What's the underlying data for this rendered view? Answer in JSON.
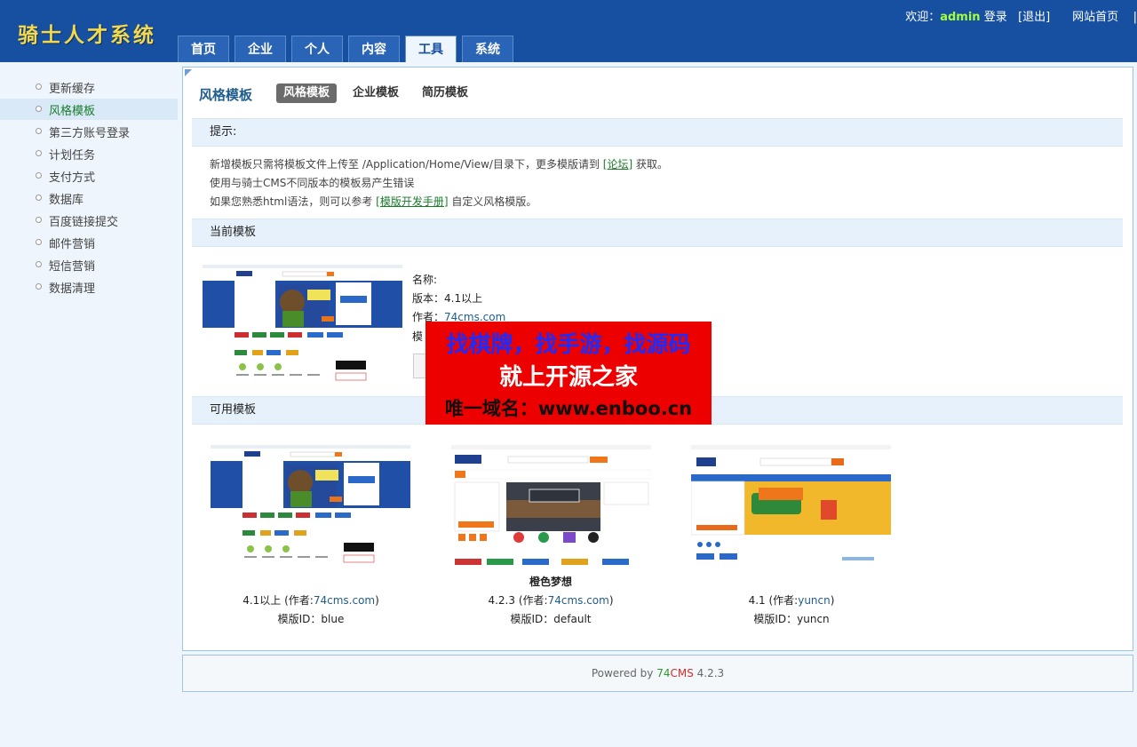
{
  "app": {
    "logo": "骑士人才系统"
  },
  "header": {
    "welcome": "欢迎：",
    "username": "admin",
    "login": "登录",
    "logout": "[退出]",
    "site_home": "网站首页",
    "separator": "|"
  },
  "nav": {
    "tabs": [
      "首页",
      "企业",
      "个人",
      "内容",
      "工具",
      "系统"
    ],
    "active": "工具"
  },
  "sidebar": {
    "items": [
      "更新缓存",
      "风格模板",
      "第三方账号登录",
      "计划任务",
      "支付方式",
      "数据库",
      "百度链接提交",
      "邮件营销",
      "短信营销",
      "数据清理"
    ],
    "active": "风格模板"
  },
  "page": {
    "title": "风格模板",
    "subtabs": [
      "风格模板",
      "企业模板",
      "简历模板"
    ],
    "active_subtab": "风格模板"
  },
  "tips": {
    "header": "提示:",
    "line1_pre": "新增模板只需将模板文件上传至 /Application/Home/View/目录下，更多模版请到 ",
    "line1_link": "[论坛]",
    "line1_post": " 获取。",
    "line2": "使用与骑士CMS不同版本的模板易产生错误",
    "line3_pre": "如果您熟悉html语法，则可以参考 ",
    "line3_link": "[模版开发手册]",
    "line3_post": " 自定义风格模版。"
  },
  "current": {
    "header": "当前模板",
    "name_label": "名称:",
    "name_value": "",
    "version_label": "版本：",
    "version_value": "4.1以上",
    "author_label": "作者：",
    "author_value": "74cms.com",
    "id_label": "模"
  },
  "available": {
    "header": "可用模板",
    "templates": [
      {
        "name": "",
        "version": "4.1以上",
        "author_label": "(作者:",
        "author": "74cms.com",
        "author_close": ")",
        "id_label": "模版ID：",
        "id": "blue"
      },
      {
        "name": "橙色梦想",
        "version": "4.2.3",
        "author_label": "(作者:",
        "author": "74cms.com",
        "author_close": ")",
        "id_label": "模版ID：",
        "id": "default"
      },
      {
        "name": "",
        "version": "4.1",
        "author_label": "(作者:",
        "author": "yuncn",
        "author_close": ")",
        "id_label": "模版ID：",
        "id": "yuncn"
      }
    ]
  },
  "footer": {
    "powered": "Powered by ",
    "brand_a": "74",
    "brand_b": "CMS",
    "version": " 4.2.3"
  },
  "overlay": {
    "line1": "找棋牌，找手游，找源码",
    "line2": "就上开源之家",
    "line3": "唯一域名：www.enboo.cn"
  },
  "colors": {
    "header_bg": "#1750a0",
    "logo": "#f4d94a",
    "accent_green": "#1a7c2a",
    "overlay_red": "#ec0000"
  }
}
